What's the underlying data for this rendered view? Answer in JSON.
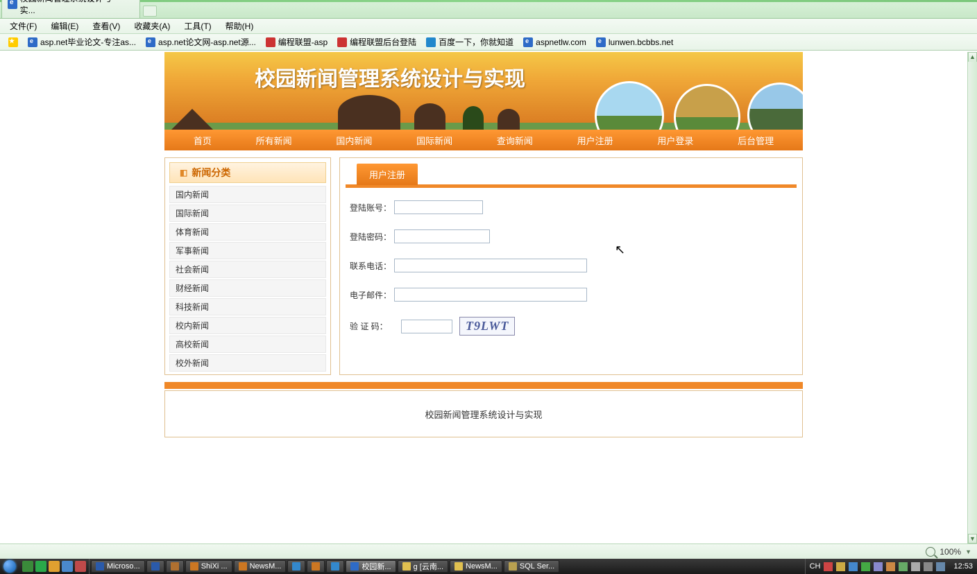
{
  "browser": {
    "tab_title": "校园新闻管理系统设计与实...",
    "menus": [
      "文件(F)",
      "编辑(E)",
      "查看(V)",
      "收藏夹(A)",
      "工具(T)",
      "帮助(H)"
    ],
    "bookmarks": [
      {
        "label": "",
        "iconClass": "star"
      },
      {
        "label": "asp.net毕业论文-专注as...",
        "iconClass": ""
      },
      {
        "label": "asp.net论文网-asp.net源...",
        "iconClass": ""
      },
      {
        "label": "编程联盟-asp",
        "iconClass": "logo1"
      },
      {
        "label": "编程联盟后台登陆",
        "iconClass": "logo1"
      },
      {
        "label": "百度一下，你就知道",
        "iconClass": "logo2"
      },
      {
        "label": "aspnetlw.com",
        "iconClass": ""
      },
      {
        "label": "lunwen.bcbbs.net",
        "iconClass": ""
      }
    ]
  },
  "site": {
    "banner_title": "校园新闻管理系统设计与实现",
    "nav": [
      "首页",
      "所有新闻",
      "国内新闻",
      "国际新闻",
      "查询新闻",
      "用户注册",
      "用户登录",
      "后台管理"
    ],
    "sidebar_title": "新闻分类",
    "sidebar_items": [
      "国内新闻",
      "国际新闻",
      "体育新闻",
      "军事新闻",
      "社会新闻",
      "财经新闻",
      "科技新闻",
      "校内新闻",
      "高校新闻",
      "校外新闻"
    ],
    "form_tab": "用户注册",
    "form": {
      "account_label": "登陆账号：",
      "password_label": "登陆密码：",
      "phone_label": "联系电话：",
      "email_label": "电子邮件：",
      "captcha_label": "验 证 码：",
      "captcha_value": "T9LWT"
    },
    "footer": "校园新闻管理系统设计与实现"
  },
  "status": {
    "zoom": "100%"
  },
  "taskbar": {
    "items": [
      {
        "label": "Microso...",
        "color": "#2a5aaa"
      },
      {
        "label": "",
        "color": "#2a5aaa"
      },
      {
        "label": "",
        "color": "#b07030"
      },
      {
        "label": "ShiXi ...",
        "color": "#cc7722"
      },
      {
        "label": "NewsM...",
        "color": "#cc7722"
      },
      {
        "label": "",
        "color": "#3388cc"
      },
      {
        "label": "",
        "color": "#cc7722"
      },
      {
        "label": "",
        "color": "#3388cc"
      },
      {
        "label": "校园新...",
        "color": "#2e6bc7",
        "active": true
      },
      {
        "label": "g [云南...",
        "color": "#e0c050"
      },
      {
        "label": "NewsM...",
        "color": "#e0c050"
      },
      {
        "label": "SQL Ser...",
        "color": "#b8a050"
      }
    ],
    "lang": "CH",
    "clock": "12:53"
  }
}
